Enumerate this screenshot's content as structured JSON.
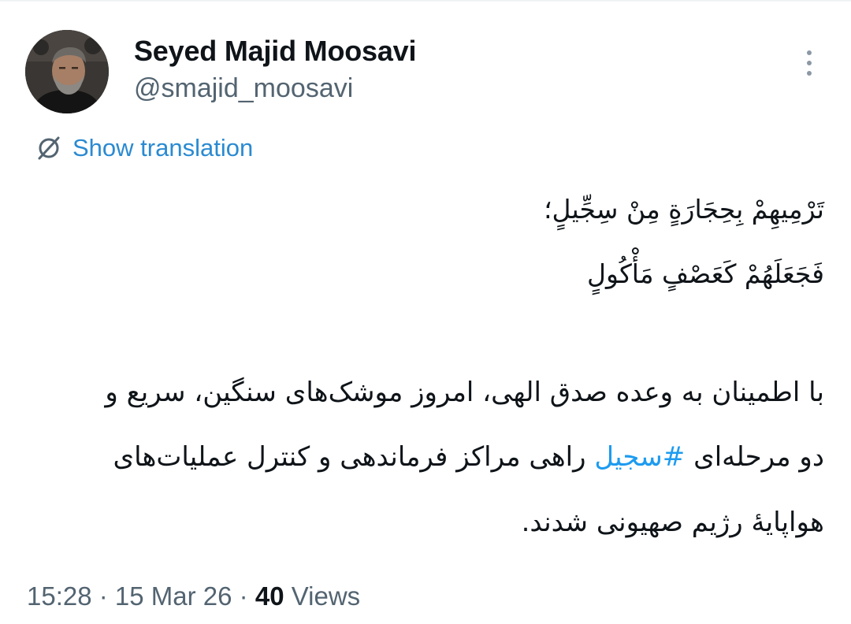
{
  "author": {
    "display_name": "Seyed Majid Moosavi",
    "handle": "@smajid_moosavi",
    "avatar_icon": "profile-photo"
  },
  "actions": {
    "more_icon": "vertical-ellipsis-icon"
  },
  "translation": {
    "icon": "globe-translate-icon",
    "label": "Show translation"
  },
  "tweet": {
    "verse_line_1": "تَرْمِيهِمْ بِحِجَارَةٍ مِنْ سِجِّيلٍ؛",
    "verse_line_2": "فَجَعَلَهُمْ كَعَصْفٍ مَأْكُولٍ",
    "prose_line_1": "با اطمینان به وعده صدق الهی، امروز موشک‌های سنگین، سریع و",
    "prose_line_2_start": "دو مرحله‌ای ",
    "hashtag": "#سجیل",
    "prose_line_2_end": " راهی مراکز فرماندهی و کنترل عملیات‌های",
    "prose_line_3": "هواپایهٔ رژیم صهیونی شدند."
  },
  "meta": {
    "time": "15:28",
    "separator_1": " · ",
    "date": "15 Mar 26",
    "separator_2": " · ",
    "views_count": "40",
    "views_label": " Views"
  },
  "colors": {
    "link": "#1d9bf0",
    "secondary_text": "#536471",
    "primary_text": "#0f1419"
  }
}
